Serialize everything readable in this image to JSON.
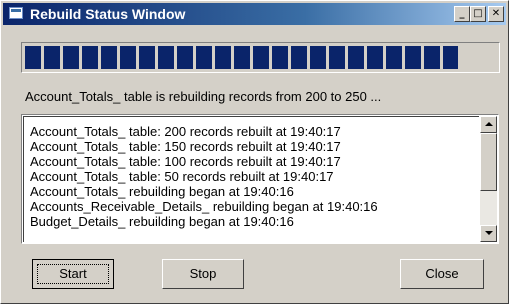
{
  "window": {
    "title": "Rebuild Status Window",
    "controls": {
      "minimize": "_",
      "maximize": "□",
      "close": "✕"
    }
  },
  "progress": {
    "value": 0.92,
    "color": "#0a246a"
  },
  "status_text": "Account_Totals_ table is rebuilding records from 200 to 250 ...",
  "log_lines": [
    "Account_Totals_ table: 200 records rebuilt at 19:40:17",
    "Account_Totals_ table: 150 records rebuilt at 19:40:17",
    "Account_Totals_ table: 100 records rebuilt at 19:40:17",
    "Account_Totals_ table: 50 records rebuilt at 19:40:17",
    "Account_Totals_ rebuilding began at 19:40:16",
    "Accounts_Receivable_Details_ rebuilding began at 19:40:16",
    "Budget_Details_ rebuilding began at 19:40:16"
  ],
  "buttons": {
    "start": "Start",
    "stop": "Stop",
    "close": "Close"
  }
}
